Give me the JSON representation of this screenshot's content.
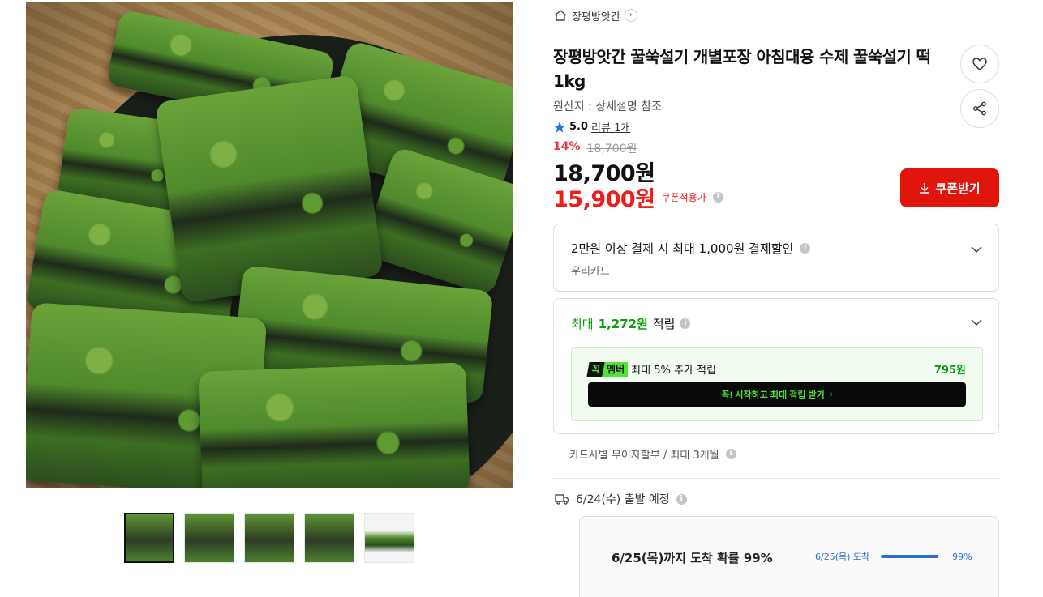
{
  "breadcrumb": {
    "store": "장평방앗간"
  },
  "product": {
    "title": "장평방앗간 꿀쑥설기 개별포장 아침대용 수제 꿀쑥설기 떡 1kg",
    "origin": "원산지 : 상세설명 참조",
    "rating": "5.0",
    "review_label": "리뷰 1개",
    "discount_pct": "14%",
    "original_price": "18,700원",
    "price": "18,700원",
    "coupon_price": "15,900원",
    "coupon_label": "쿠폰적용가",
    "coupon_button": "쿠폰받기"
  },
  "card_discount": {
    "main": "2만원 이상 결제 시 최대 1,000원 결제할인",
    "sub": "우리카드"
  },
  "points": {
    "prefix": "최대",
    "amount": "1,272원",
    "suffix": "적립",
    "badge_left": "꼭",
    "badge_right": "멤버",
    "member_text": "최대 5% 추가 적립",
    "member_amount": "795원",
    "start_button": "꼭! 시작하고 최대 적립 받기"
  },
  "installment": "카드사별 무이자할부 / 최대 3개월",
  "shipping": {
    "depart": "6/24(수) 출발 예정",
    "arrival_main": "6/25(목)까지 도착 확률 99%",
    "arrival_label": "6/25(목) 도착",
    "arrival_pct_text": "99%",
    "arrival_fraction": 0.99
  },
  "colors": {
    "accent_red": "#e0150c",
    "price_red": "#f01b1b",
    "green": "#0f9b12",
    "blue": "#2a6fdb"
  },
  "icons": [
    "home-icon",
    "chevron-right-icon",
    "heart-icon",
    "share-icon",
    "star-icon",
    "info-icon",
    "download-icon",
    "chevron-down-icon",
    "truck-icon"
  ]
}
